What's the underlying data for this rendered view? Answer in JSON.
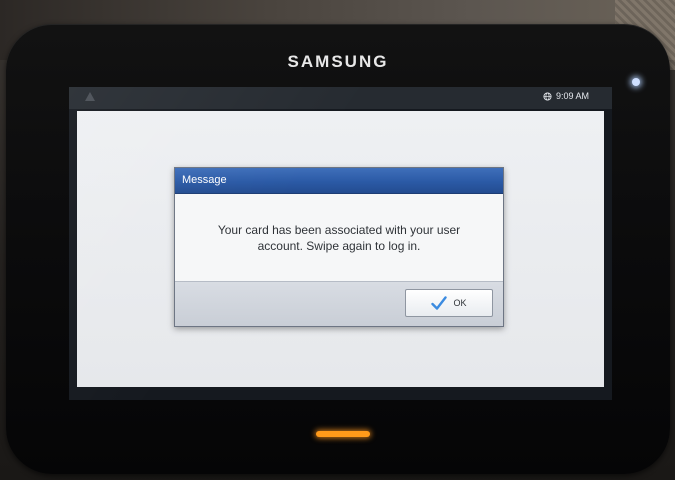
{
  "device": {
    "brand": "SAMSUNG"
  },
  "status_bar": {
    "time": "9:09 AM",
    "icons": [
      "warning-icon",
      "globe-icon"
    ]
  },
  "dialog": {
    "title": "Message",
    "message": "Your card has been associated with your user account. Swipe again to log in.",
    "ok_label": "OK",
    "ok_icon": "check-icon"
  },
  "colors": {
    "title_bar": "#2b5aa6",
    "ok_check": "#3b8be0",
    "home_led": "#ff9a1a"
  }
}
